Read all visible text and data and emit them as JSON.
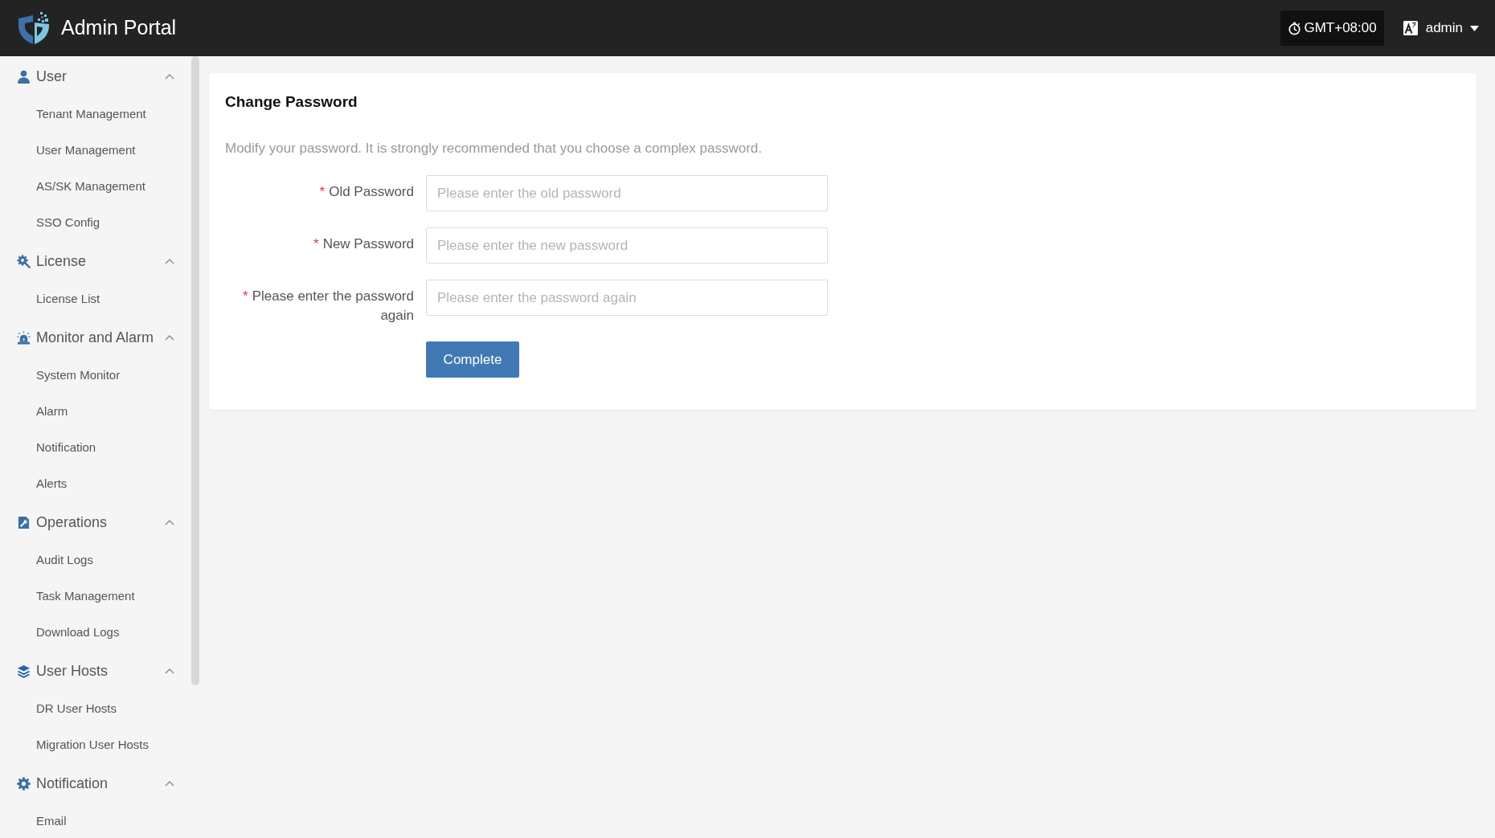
{
  "header": {
    "title": "Admin Portal",
    "timezone": "GMT+08:00",
    "user": "admin"
  },
  "sidebar": {
    "groups": [
      {
        "label": "User",
        "expanded": true,
        "items": [
          {
            "label": "Tenant Management",
            "selected": false
          },
          {
            "label": "User Management",
            "selected": false
          },
          {
            "label": "AS/SK Management",
            "selected": false
          },
          {
            "label": "SSO Config",
            "selected": false
          }
        ]
      },
      {
        "label": "License",
        "expanded": true,
        "items": [
          {
            "label": "License List",
            "selected": false
          }
        ]
      },
      {
        "label": "Monitor and Alarm",
        "expanded": true,
        "items": [
          {
            "label": "System Monitor",
            "selected": false
          },
          {
            "label": "Alarm",
            "selected": false
          },
          {
            "label": "Notification",
            "selected": false
          },
          {
            "label": "Alerts",
            "selected": false
          }
        ]
      },
      {
        "label": "Operations",
        "expanded": true,
        "items": [
          {
            "label": "Audit Logs",
            "selected": false
          },
          {
            "label": "Task Management",
            "selected": false
          },
          {
            "label": "Download Logs",
            "selected": false
          }
        ]
      },
      {
        "label": "User Hosts",
        "expanded": true,
        "items": [
          {
            "label": "DR User Hosts",
            "selected": false
          },
          {
            "label": "Migration User Hosts",
            "selected": false
          }
        ]
      },
      {
        "label": "Notification",
        "expanded": true,
        "items": [
          {
            "label": "Email",
            "selected": false
          }
        ]
      }
    ]
  },
  "page": {
    "title": "Change Password",
    "description": "Modify your password. It is strongly recommended that you choose a complex password.",
    "fields": [
      {
        "required_mark": "*",
        "label": "Old Password",
        "placeholder": "Please enter the old password"
      },
      {
        "required_mark": "*",
        "label": "New Password",
        "placeholder": "Please enter the new password"
      },
      {
        "required_mark": "*",
        "label": "Please enter the password again",
        "placeholder": "Please enter the password again"
      }
    ],
    "submit": "Complete"
  }
}
